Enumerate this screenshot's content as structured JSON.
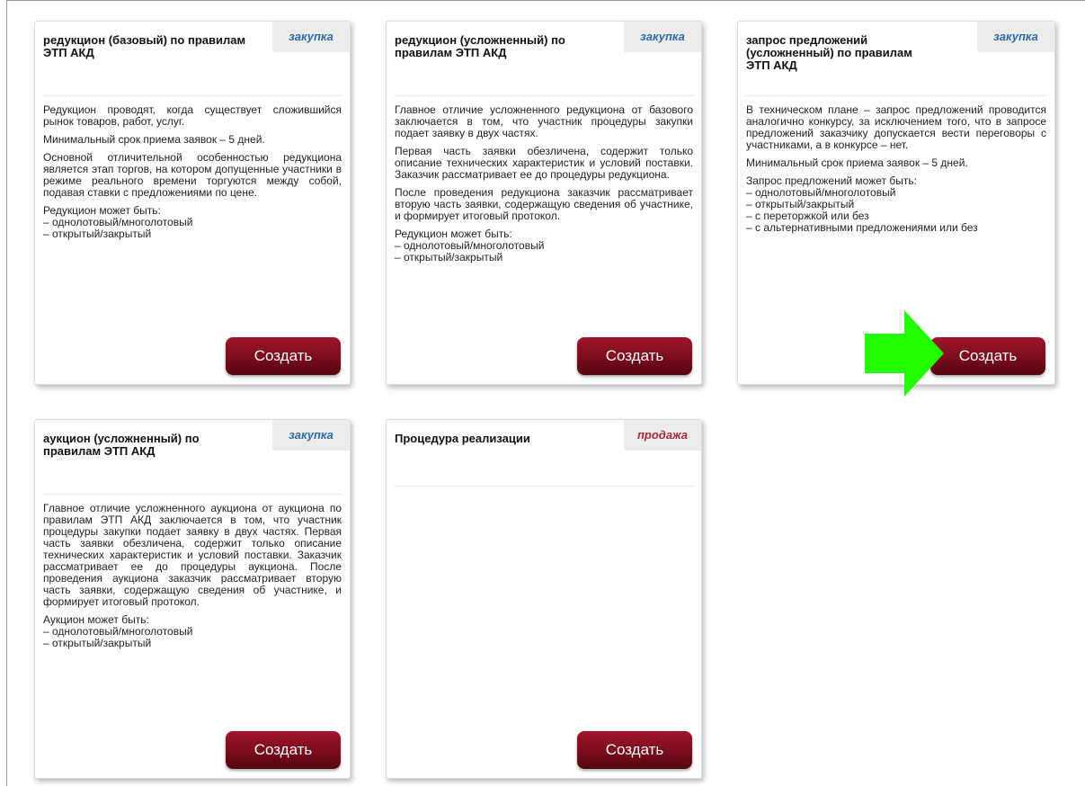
{
  "cards": [
    {
      "title": "редукцион (базовый) по правилам ЭТП АКД",
      "type": "закупка",
      "paragraphs": [
        "Редукцион проводят, когда существует сложившийся рынок товаров, работ, услуг.",
        "Минимальный срок приема заявок – 5 дней.",
        "Основной отличительной особенностью редукциона является этап торгов, на котором допущенные участники в режиме реального времени торгуются между собой, подавая ставки с предложениями по цене."
      ],
      "list_title": "Редукцион может быть:",
      "list": [
        "– однолотовый/многолотовый",
        "– открытый/закрытый"
      ],
      "button": "Создать"
    },
    {
      "title": "редукцион (усложненный) по правилам ЭТП АКД",
      "type": "закупка",
      "paragraphs": [
        "Главное отличие усложненного редукциона от базового заключается в том, что участник процедуры закупки подает заявку в двух частях.",
        "Первая часть заявки обезличена, содержит только описание технических характеристик и условий поставки. Заказчик рассматривает ее до процедуры редукциона.",
        "После проведения редукциона заказчик рассматривает вторую часть заявки, содержащую сведения об участнике, и формирует итоговый протокол."
      ],
      "list_title": "Редукцион может быть:",
      "list": [
        "– однолотовый/многолотовый",
        "– открытый/закрытый"
      ],
      "button": "Создать"
    },
    {
      "title": "запрос предложений (усложненный) по правилам ЭТП АКД",
      "type": "закупка",
      "paragraphs": [
        "В техническом плане – запрос предложений проводится аналогично конкурсу, за исключением того, что в запросе предложений заказчику допускается вести переговоры с участниками, а в конкурсе – нет.",
        "Минимальный срок приема заявок – 5 дней."
      ],
      "list_title": "Запрос предложений может быть:",
      "list": [
        "– однолотовый/многолотовый",
        "– открытый/закрытый",
        "– с переторжкой или без",
        "– с альтернативными предложениями или без"
      ],
      "button": "Создать"
    },
    {
      "title": "аукцион (усложненный) по правилам ЭТП АКД",
      "type": "закупка",
      "paragraphs": [
        "Главное отличие усложненного аукциона от аукциона по правилам ЭТП АКД заключается в том, что участник процедуры закупки подает заявку в двух частях. Первая часть заявки обезличена, содержит только описание технических характеристик и условий поставки. Заказчик рассматривает ее до процедуры аукциона. После проведения аукциона заказчик рассматривает вторую часть заявки, содержащую сведения об участнике, и формирует итоговый протокол."
      ],
      "list_title": "Аукцион может быть:",
      "list": [
        "– однолотовый/многолотовый",
        "– открытый/закрытый"
      ],
      "button": "Создать"
    },
    {
      "title": "Процедура реализации",
      "type": "продажа",
      "paragraphs": [],
      "list_title": "",
      "list": [],
      "button": "Создать"
    }
  ],
  "colors": {
    "type_buy": "#2b6ba8",
    "type_sell": "#a8283a",
    "button": "#7a0c1d",
    "arrow": "#22ff00"
  },
  "icons": {
    "highlight": "green-arrow-icon"
  }
}
